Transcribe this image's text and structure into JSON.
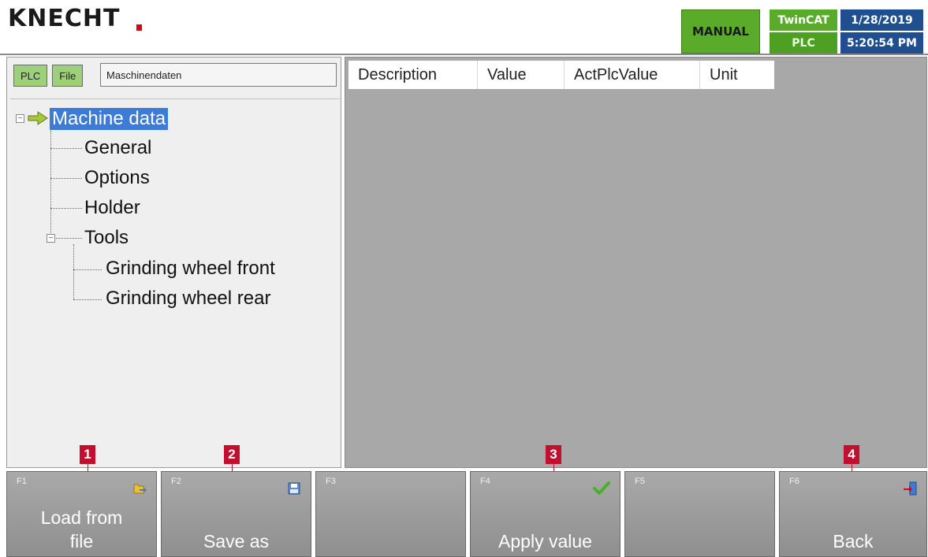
{
  "header": {
    "logo": "KNECHT",
    "mode": "MANUAL",
    "twincat": "TwinCAT",
    "plc_status": "PLC",
    "date": "1/28/2019",
    "time": "5:20:54 PM"
  },
  "sidebar": {
    "chip_plc": "PLC",
    "chip_file": "File",
    "path": "Maschinendaten",
    "tree": [
      {
        "label": "Machine data"
      },
      {
        "label": "General"
      },
      {
        "label": "Options"
      },
      {
        "label": "Holder"
      },
      {
        "label": "Tools"
      },
      {
        "label": "Grinding wheel front"
      },
      {
        "label": "Grinding wheel rear"
      }
    ]
  },
  "table": {
    "columns": [
      "Description",
      "Value",
      "ActPlcValue",
      "Unit"
    ]
  },
  "function_keys": [
    {
      "key": "F1",
      "label_line1": "Load  from",
      "label_line2": "file",
      "icon": "folder-load-icon"
    },
    {
      "key": "F2",
      "label_line1": "",
      "label_line2": "Save as",
      "icon": "save-disk-icon"
    },
    {
      "key": "F3",
      "label_line1": "",
      "label_line2": "",
      "icon": ""
    },
    {
      "key": "F4",
      "label_line1": "",
      "label_line2": "Apply value",
      "icon": "checkmark-icon"
    },
    {
      "key": "F5",
      "label_line1": "",
      "label_line2": "",
      "icon": ""
    },
    {
      "key": "F6",
      "label_line1": "",
      "label_line2": "Back",
      "icon": "exit-door-icon"
    }
  ],
  "callouts": [
    "1",
    "2",
    "3",
    "4"
  ],
  "colors": {
    "mode_green": "#5bab2b",
    "datetime_blue": "#1f4f8f",
    "selection_blue": "#3d7bd4",
    "callout_red": "#c0102e",
    "brand_red": "#d9001b"
  }
}
